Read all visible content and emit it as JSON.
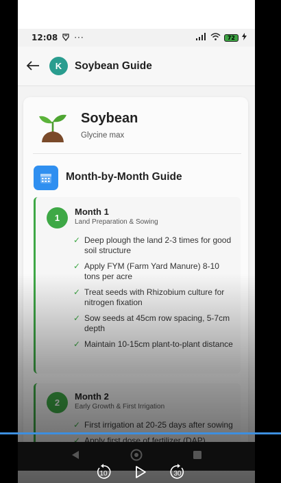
{
  "status_bar": {
    "time": "12:08",
    "battery": "72"
  },
  "app_bar": {
    "back_icon": "back-arrow-icon",
    "avatar_letter": "K",
    "title": "Soybean Guide"
  },
  "crop": {
    "name": "Soybean",
    "scientific_name": "Glycine max"
  },
  "section": {
    "title": "Month-by-Month Guide",
    "icon": "calendar-icon"
  },
  "months": [
    {
      "number": "1",
      "title": "Month 1",
      "subtitle": "Land Preparation & Sowing",
      "tasks": [
        "Deep plough the land 2-3 times for good soil structure",
        "Apply FYM (Farm Yard Manure) 8-10 tons per acre",
        "Treat seeds with Rhizobium culture for nitrogen fixation",
        "Sow seeds at 45cm row spacing, 5-7cm depth",
        "Maintain 10-15cm plant-to-plant distance"
      ]
    },
    {
      "number": "2",
      "title": "Month 2",
      "subtitle": "Early Growth & First Irrigation",
      "tasks": [
        "First irrigation at 20-25 days after sowing",
        "Apply first dose of fertilizer (DAP)"
      ]
    }
  ],
  "check_mark": "✓",
  "video": {
    "progress": 1.0,
    "rewind_seconds": "10",
    "forward_seconds": "30"
  },
  "colors": {
    "accent_green": "#3ea846",
    "avatar_teal": "#2a9d8f",
    "calendar_blue": "#2f8ff0",
    "progress_blue": "#3d8fe0"
  }
}
